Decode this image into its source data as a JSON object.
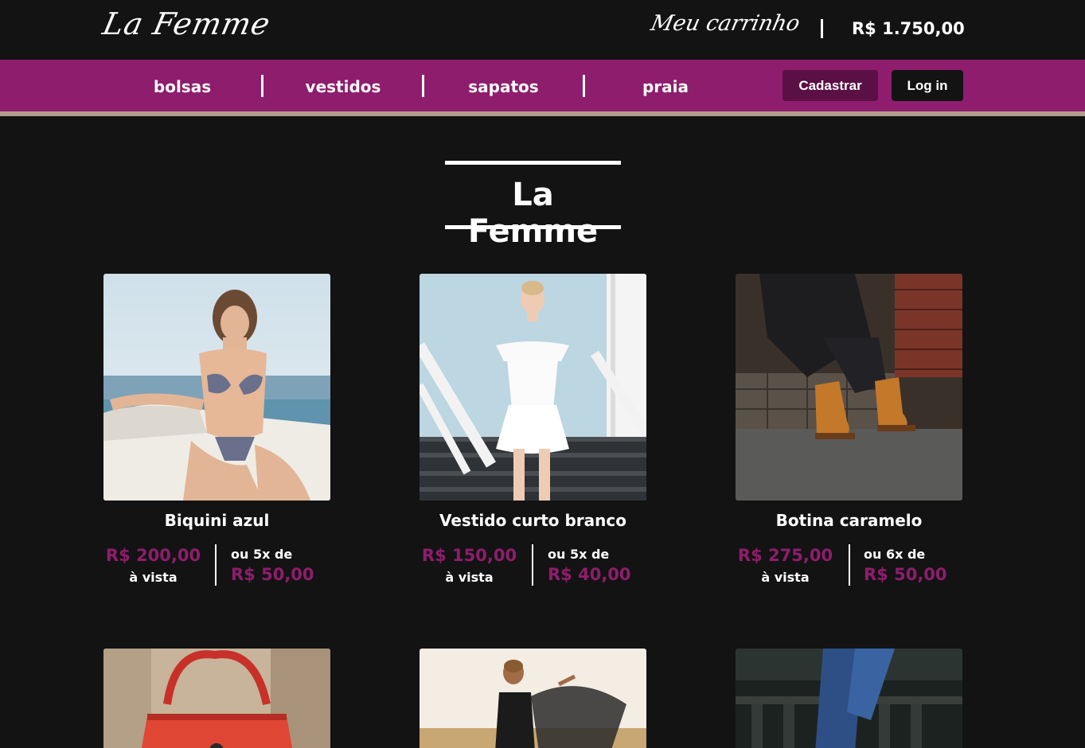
{
  "header": {
    "logo": "La Femme",
    "cart_label": "Meu carrinho",
    "cart_total": "R$ 1.750,00"
  },
  "nav": {
    "links": [
      "bolsas",
      "vestidos",
      "sapatos",
      "praia"
    ],
    "register_label": "Cadastrar",
    "login_label": "Log in"
  },
  "main": {
    "title": "La Femme",
    "products": [
      {
        "name": "Biquini azul",
        "cash_price": "R$ 200,00",
        "cash_label": "à vista",
        "installments_label": "ou 5x de",
        "installment_value": "R$ 50,00"
      },
      {
        "name": "Vestido curto branco",
        "cash_price": "R$ 150,00",
        "cash_label": "à vista",
        "installments_label": "ou 5x de",
        "installment_value": "R$ 40,00"
      },
      {
        "name": "Botina caramelo",
        "cash_price": "R$ 275,00",
        "cash_label": "à vista",
        "installments_label": "ou 6x de",
        "installment_value": "R$ 50,00"
      }
    ]
  },
  "colors": {
    "brand": "#8e1d6d",
    "background": "#131313",
    "strip": "#b19e8e"
  }
}
